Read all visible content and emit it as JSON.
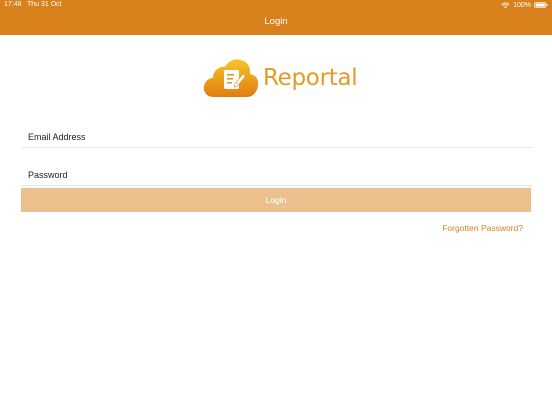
{
  "status_bar": {
    "time": "17:48",
    "date": "Thu 31 Oct",
    "battery": "100%",
    "wifi_icon": "wifi-icon",
    "battery_icon": "battery-icon"
  },
  "nav": {
    "title": "Login"
  },
  "logo": {
    "text": "Reportal",
    "icon": "cloud-document-icon"
  },
  "form": {
    "email_placeholder": "Email Address",
    "email_value": "",
    "password_placeholder": "Password",
    "password_value": "",
    "login_label": "Login",
    "forgot_label": "Forgotten Password?"
  },
  "colors": {
    "accent": "#d8801c",
    "button_disabled": "#ebc08d",
    "logo_text": "#e39b23"
  }
}
